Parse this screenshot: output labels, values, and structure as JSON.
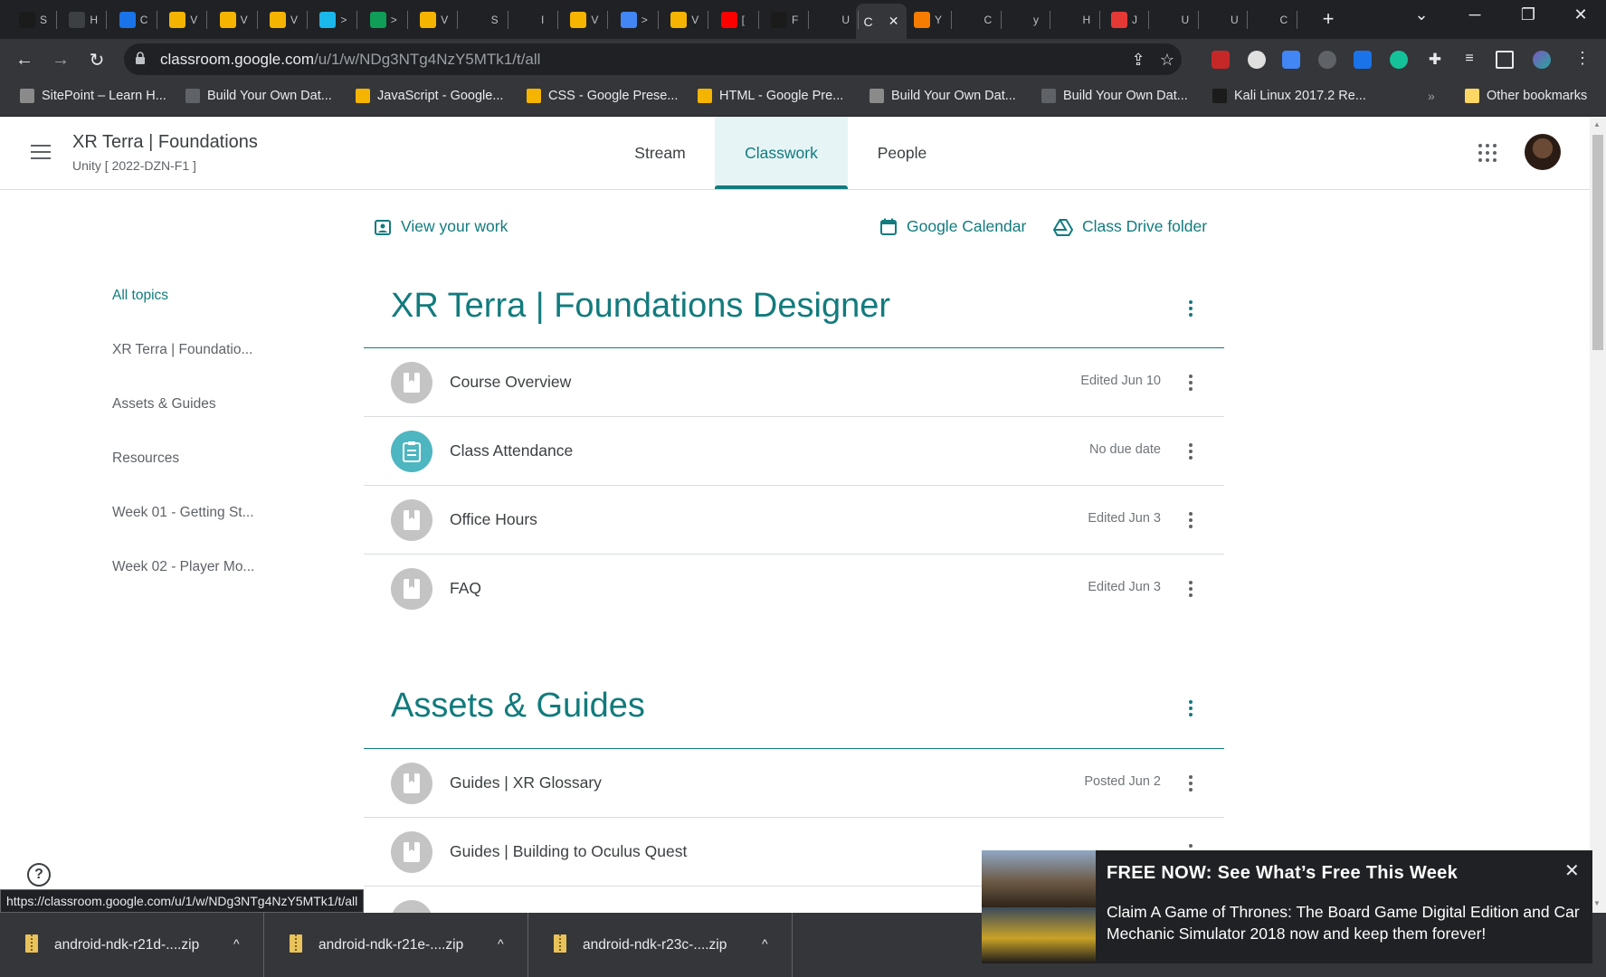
{
  "browser": {
    "active_tab_letter": "C",
    "new_tab_label": "+",
    "url_host": "classroom.google.com",
    "url_path": "/u/1/w/NDg3NTg4NzY5MTk1/t/all",
    "tabs": [
      {
        "letter": "S",
        "color": "#1b1b1b",
        "icon": "stack-icon"
      },
      {
        "letter": "H",
        "color": "#3c4043",
        "icon": "globe-icon"
      },
      {
        "letter": "C",
        "color": "#1a73e8",
        "icon": "classroom-icon"
      },
      {
        "letter": "V",
        "color": "#f4b400",
        "icon": "slides-icon"
      },
      {
        "letter": "V",
        "color": "#f4b400",
        "icon": "slides-icon"
      },
      {
        "letter": "V",
        "color": "#f4b400",
        "icon": "slides-icon"
      },
      {
        "letter": ">",
        "color": "#1ab7ea",
        "icon": "vimeo-icon"
      },
      {
        "letter": ">",
        "color": "#0f9d58",
        "icon": "drive-icon"
      },
      {
        "letter": "V",
        "color": "#f4b400",
        "icon": "slides-icon"
      },
      {
        "letter": "S",
        "color": "#202124",
        "icon": "power-icon"
      },
      {
        "letter": "I",
        "color": "#202124",
        "icon": "power-icon"
      },
      {
        "letter": "V",
        "color": "#f4b400",
        "icon": "slides-icon"
      },
      {
        "letter": ">",
        "color": "#4285f4",
        "icon": "docs-icon"
      },
      {
        "letter": "V",
        "color": "#f4b400",
        "icon": "slides-icon"
      },
      {
        "letter": "[",
        "color": "#ff0000",
        "icon": "youtube-icon"
      },
      {
        "letter": "F",
        "color": "#1b1b1b",
        "icon": "stack-icon"
      },
      {
        "letter": "U",
        "color": "#202124",
        "icon": "visual-studio-icon"
      }
    ],
    "tabs_right": [
      {
        "letter": "Y",
        "color": "#f57c00",
        "icon": "crunchyroll-icon"
      },
      {
        "letter": "C",
        "color": "#202124",
        "icon": "oculus-icon"
      },
      {
        "letter": "y",
        "color": "#202124",
        "icon": "unity-icon"
      },
      {
        "letter": "H",
        "color": "#202124",
        "icon": "terminal-icon"
      },
      {
        "letter": "J",
        "color": "#e53935",
        "icon": "oculus-icon"
      },
      {
        "letter": "U",
        "color": "#202124",
        "icon": "unity-icon"
      },
      {
        "letter": "U",
        "color": "#202124",
        "icon": "unity-icon"
      },
      {
        "letter": "C",
        "color": "#202124",
        "icon": "oculus-icon"
      }
    ],
    "bookmarks": [
      {
        "label": "SitePoint – Learn H...",
        "icon": "sitepoint-icon",
        "color": "#8a8a8a"
      },
      {
        "label": "Build Your Own Dat...",
        "icon": "sitepoint-icon",
        "color": "#5f6368"
      },
      {
        "label": "JavaScript - Google...",
        "icon": "slides-icon",
        "color": "#f4b400"
      },
      {
        "label": "CSS - Google Prese...",
        "icon": "slides-icon",
        "color": "#f4b400"
      },
      {
        "label": "HTML - Google Pre...",
        "icon": "slides-icon",
        "color": "#f4b400"
      },
      {
        "label": "Build Your Own Dat...",
        "icon": "sitepoint-icon",
        "color": "#8a8a8a"
      },
      {
        "label": "Build Your Own Dat...",
        "icon": "sitepoint-icon",
        "color": "#5f6368"
      },
      {
        "label": "Kali Linux 2017.2 Re...",
        "icon": "kali-icon",
        "color": "#1b1b1b"
      }
    ],
    "bookmarks_more": "»",
    "other_bookmarks": "Other bookmarks",
    "status_url": "https://classroom.google.com/u/1/w/NDg3NTg4NzY5MTk1/t/all"
  },
  "header": {
    "class_name": "XR Terra | Foundations",
    "class_section": "Unity [ 2022-DZN-F1 ]",
    "tabs": [
      "Stream",
      "Classwork",
      "People"
    ],
    "active_tab": "Classwork"
  },
  "actions": {
    "view_work": "View your work",
    "calendar": "Google Calendar",
    "drive": "Class Drive folder"
  },
  "topics": [
    "All topics",
    "XR Terra | Foundatio...",
    "Assets & Guides",
    "Resources",
    "Week 01 - Getting St...",
    "Week 02 - Player Mo..."
  ],
  "sections": [
    {
      "title": "XR Terra | Foundations Designer",
      "items": [
        {
          "title": "Course Overview",
          "meta": "Edited Jun 10",
          "kind": "material"
        },
        {
          "title": "Class Attendance",
          "meta": "No due date",
          "kind": "assignment"
        },
        {
          "title": "Office Hours",
          "meta": "Edited Jun 3",
          "kind": "material"
        },
        {
          "title": "FAQ",
          "meta": "Edited Jun 3",
          "kind": "material"
        }
      ]
    },
    {
      "title": "Assets & Guides",
      "items": [
        {
          "title": "Guides | XR Glossary",
          "meta": "Posted Jun 2",
          "kind": "material"
        },
        {
          "title": "Guides | Building to Oculus Quest",
          "meta": "",
          "kind": "material"
        }
      ]
    }
  ],
  "help_label": "?",
  "downloads": [
    {
      "name": "android-ndk-r21d-....zip",
      "caret": "^"
    },
    {
      "name": "android-ndk-r21e-....zip",
      "caret": "^"
    },
    {
      "name": "android-ndk-r23c-....zip",
      "caret": "^"
    }
  ],
  "promo": {
    "title": "FREE NOW: See What’s Free This Week",
    "body": "Claim A Game of Thrones: The Board Game Digital Edition and Car Mechanic Simulator 2018 now and keep them forever!",
    "close": "✕"
  },
  "colors": {
    "accent": "#127b7d",
    "assignment_icon": "#4db6c1",
    "material_icon": "#c4c4c4",
    "chrome_dark": "#202124",
    "chrome_mid": "#35363a"
  }
}
